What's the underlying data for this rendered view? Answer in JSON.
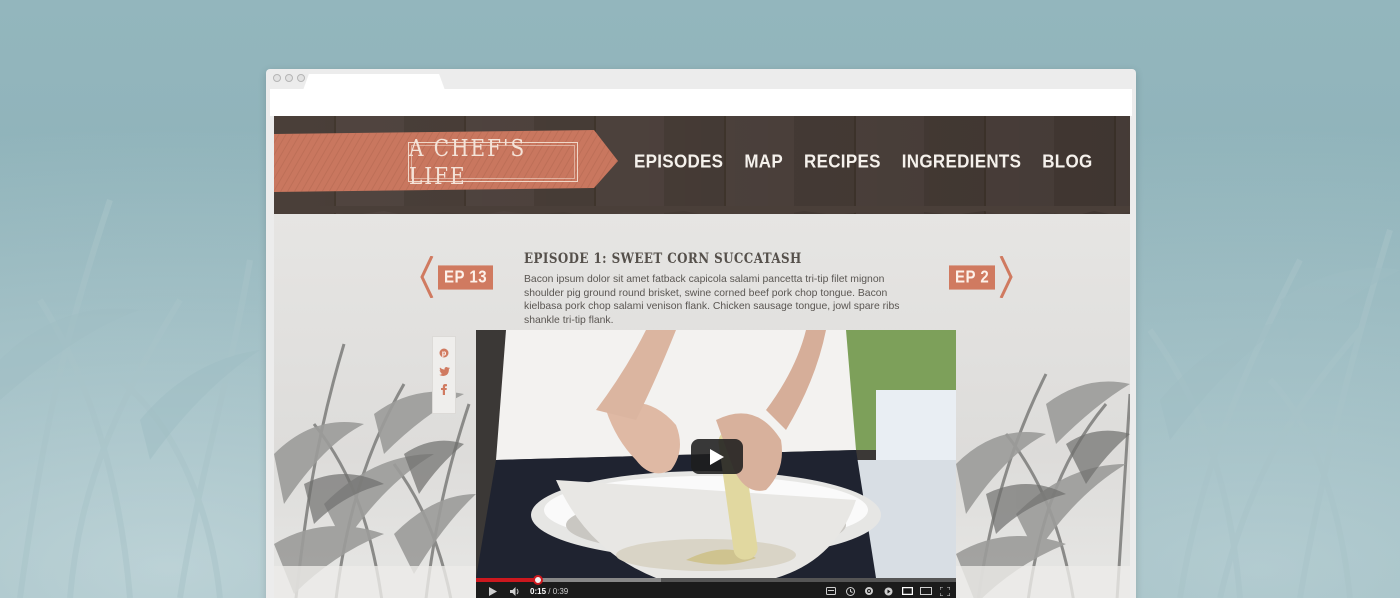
{
  "site": {
    "logo": "A CHEF'S LIFE",
    "nav": [
      "EPISODES",
      "MAP",
      "RECIPES",
      "INGREDIENTS",
      "BLOG"
    ]
  },
  "episode": {
    "prev_label": "EP 13",
    "next_label": "EP 2",
    "title": "EPISODE 1: SWEET CORN SUCCATASH",
    "description": "Bacon ipsum dolor sit amet fatback capicola salami pancetta tri-tip filet mignon shoulder pig ground round brisket, swine corned beef pork chop tongue. Bacon kielbasa pork chop salami venison flank. Chicken sausage tongue, jowl spare ribs shankle tri-tip flank."
  },
  "share": {
    "icons": [
      "pinterest-icon",
      "twitter-icon",
      "facebook-icon"
    ]
  },
  "video": {
    "current_time": "0:15",
    "separator": " / ",
    "duration": "0:39",
    "progress_fraction": 0.385,
    "buffer_fraction": 0.35,
    "played_fraction": 0.13,
    "controls": [
      "play-icon",
      "volume-icon",
      "captions-icon",
      "watch-later-icon",
      "settings-icon",
      "youtube-icon",
      "small-player-icon",
      "large-player-icon",
      "fullscreen-icon"
    ]
  },
  "colors": {
    "accent": "#d07a60",
    "header": "#4a3f39",
    "background": "#8fb3ba",
    "progress": "#cc181e"
  }
}
